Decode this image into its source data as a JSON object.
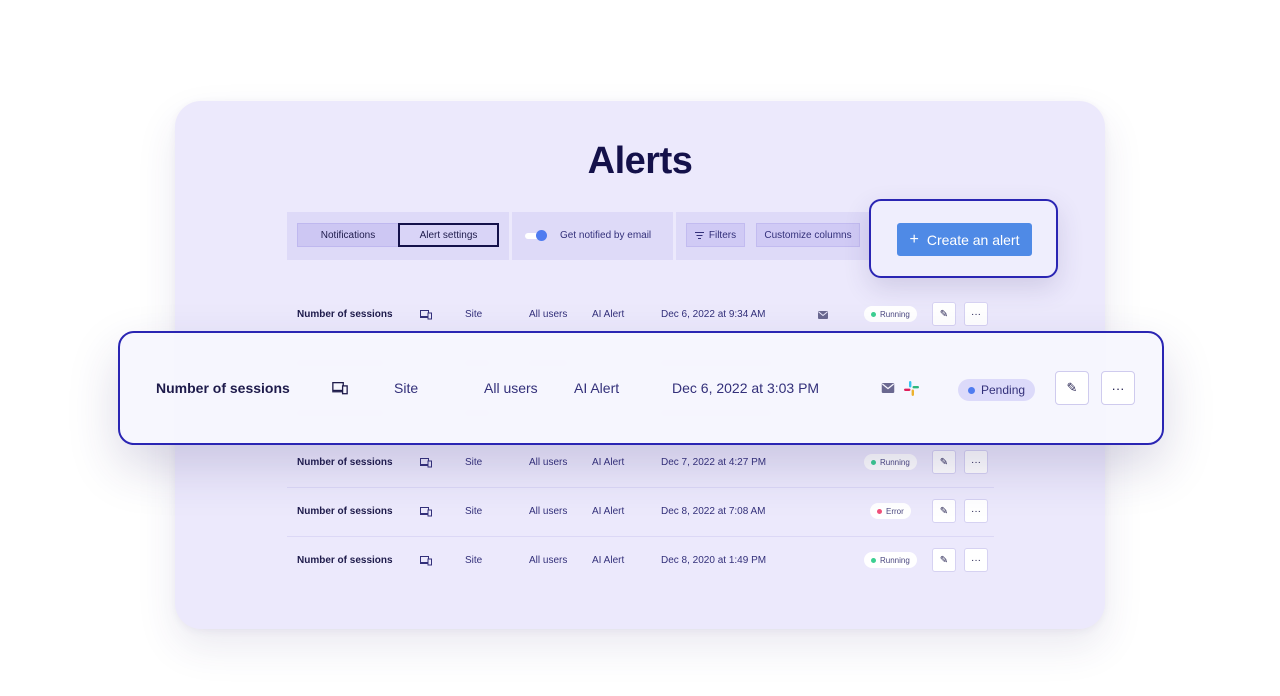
{
  "page": {
    "title": "Alerts"
  },
  "toolbar": {
    "tabs": [
      {
        "label": "Notifications",
        "active": false
      },
      {
        "label": "Alert settings",
        "active": true
      }
    ],
    "email_toggle": {
      "label": "Get notified by email",
      "on": true
    },
    "filters_label": "Filters",
    "customize_label": "Customize columns",
    "create_label": "Create an alert"
  },
  "rows": [
    {
      "name": "Number of sessions",
      "device_icon": "devices-icon",
      "scope": "Site",
      "users": "All users",
      "type": "AI Alert",
      "date": "Dec 6, 2022 at 9:34 AM",
      "channels": [
        "mail-icon"
      ],
      "status": "Running",
      "status_color": "#3ccf91"
    },
    {
      "name": "Number of sessions",
      "device_icon": "devices-icon",
      "scope": "Site",
      "users": "All users",
      "type": "AI Alert",
      "date": "Dec 7, 2022 at 4:27 PM",
      "channels": [],
      "status": "Running",
      "status_color": "#3ccf91"
    },
    {
      "name": "Number of sessions",
      "device_icon": "devices-icon",
      "scope": "Site",
      "users": "All users",
      "type": "AI Alert",
      "date": "Dec 8, 2022 at 7:08 AM",
      "channels": [],
      "status": "Error",
      "status_color": "#f0507a"
    },
    {
      "name": "Number of sessions",
      "device_icon": "devices-icon",
      "scope": "Site",
      "users": "All users",
      "type": "AI Alert",
      "date": "Dec 8, 2020 at 1:49 PM",
      "channels": [],
      "status": "Running",
      "status_color": "#3ccf91"
    }
  ],
  "featured_row": {
    "name": "Number of sessions",
    "device_icon": "devices-icon",
    "scope": "Site",
    "users": "All users",
    "type": "AI Alert",
    "date": "Dec 6, 2022 at 3:03 PM",
    "channels": [
      "mail-icon",
      "slack-icon"
    ],
    "status": "Pending",
    "status_color": "#4f7cf0"
  },
  "colors": {
    "accent": "#4f8ae6",
    "highlight_border": "#2a25b3",
    "card_bg": "#ece9fc"
  }
}
